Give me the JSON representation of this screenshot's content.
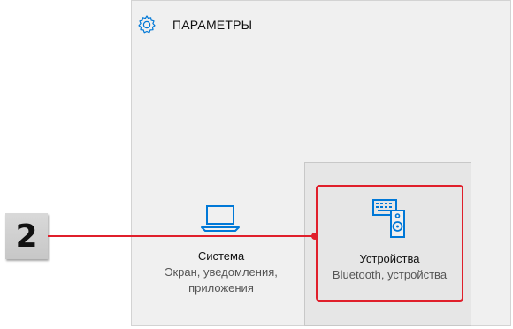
{
  "window": {
    "title": "ПАРАМЕТРЫ"
  },
  "tiles": [
    {
      "name": "Система",
      "desc_line1": "Экран, уведомления,",
      "desc_line2": "приложения",
      "icon": "laptop-icon"
    },
    {
      "name": "Устройства",
      "desc_line1": "Bluetooth, устройства",
      "icon": "devices-icon"
    }
  ],
  "callout": {
    "number": "2"
  },
  "colors": {
    "accent": "#0078d7",
    "highlight": "#e01f2b",
    "background": "#f0f0f0"
  }
}
